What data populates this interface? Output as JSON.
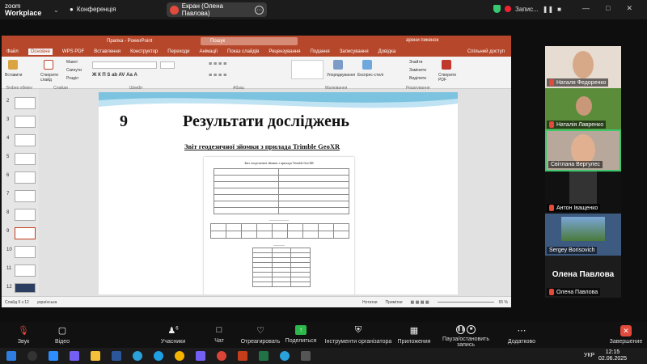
{
  "zoom": {
    "logo_line1": "zoom",
    "logo_line2": "Workplace",
    "conference_label": "Конференція",
    "screen_share_label": "Екран (Олена Павлова)",
    "recording_label": "Запис...",
    "colors": {
      "accent_green": "#2eb84b",
      "end_red": "#e24a3c"
    }
  },
  "powerpoint": {
    "title": "Прапка - PowerPoint",
    "search_placeholder": "Пошук",
    "user": "арени пикенок",
    "tabs": [
      "Файл",
      "Основне",
      "WPS PDF",
      "Вставлення",
      "Конструктор",
      "Переходи",
      "Анімації",
      "Показ слайдів",
      "Рецензування",
      "Подання",
      "Записування",
      "Довідка"
    ],
    "active_tab": "Основне",
    "share_button": "Спільний доступ",
    "ribbon_groups": [
      "Буфер обміну",
      "Слайди",
      "Шрифт",
      "Абзац",
      "Малювання",
      "Редагування"
    ],
    "ribbon_buttons": {
      "paste": "Вставити",
      "new_slide": "Створити слайд",
      "layout": "Макет",
      "reset": "Скинути",
      "section": "Розділ",
      "arrange": "Упорядкування",
      "express_styles": "Експрес-стилі",
      "find": "Знайти",
      "replace": "Замінити",
      "select": "Виділити",
      "create_pdf": "Створити PDF"
    },
    "thumbnail_numbers": [
      "2",
      "3",
      "4",
      "5",
      "6",
      "7",
      "8",
      "9",
      "10",
      "11",
      "12"
    ],
    "selected_thumbnail": "9",
    "status_left": "Слайд 9 з 12",
    "status_lang": "українська",
    "status_notes": "Нотатки",
    "status_comments": "Примітки",
    "zoom_level": "65 %"
  },
  "slide": {
    "number": "9",
    "title": "Результати досліджень",
    "subtitle": "Звіт геодезичної зйомки з прилада Trimble GeoXR"
  },
  "participants": [
    {
      "name": "Наталя Федоренко"
    },
    {
      "name": "Наталія Лавренко"
    },
    {
      "name": "Світлана Вергулес"
    },
    {
      "name": "Антон Іващенко"
    },
    {
      "name": "Sergey Borisovich"
    },
    {
      "name": "Олена Павлова",
      "big_label": "Олена Павлова"
    }
  ],
  "toolbar": {
    "mute": "Звук",
    "video": "Відео",
    "participants": "Учасники",
    "participants_count": "6",
    "chat": "Чат",
    "react": "Отреагировать",
    "share": "Поделиться",
    "org_tools": "Інструменти організатора",
    "apps": "Приложения",
    "pause_record": "Пауза/остановить запись",
    "more": "Додатково",
    "end": "Завершение"
  },
  "taskbar": {
    "language": "УКР",
    "time": "12:15",
    "date": "02.06.2025"
  }
}
